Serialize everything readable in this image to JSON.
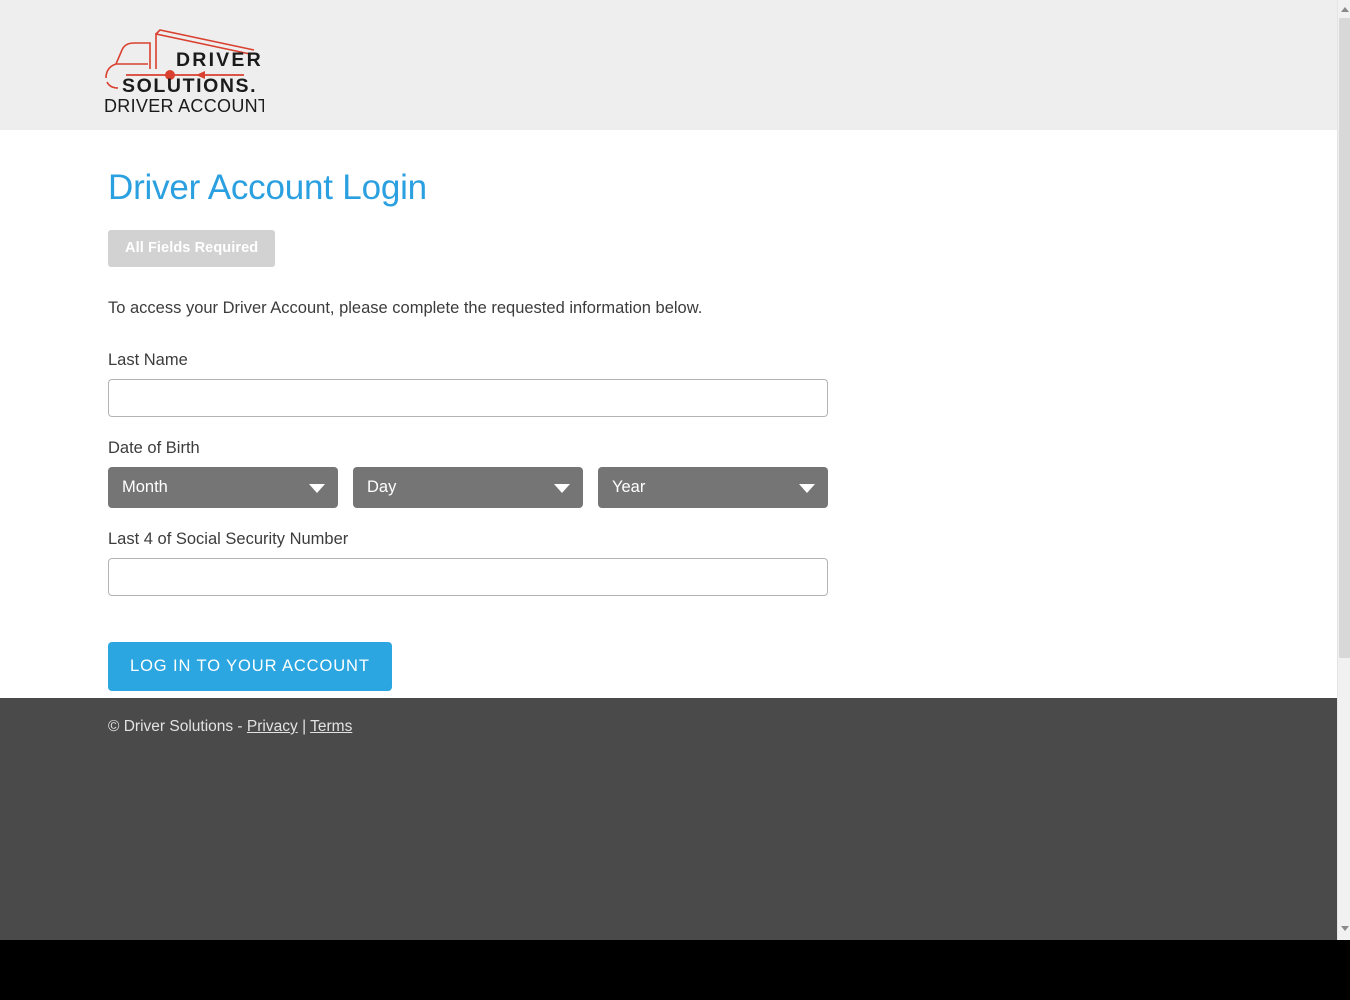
{
  "header": {
    "logo": {
      "name": "driver-solutions-logo",
      "line1": "DRIVER",
      "line2": "SOLUTIONS",
      "line3": "DRIVER ACCOUNT",
      "truck_color": "#d9402f",
      "text_color": "#1b1b1b"
    }
  },
  "main": {
    "title": "Driver Account Login",
    "badge": "All Fields Required",
    "intro": "To access your Driver Account, please complete the requested information below.",
    "fields": {
      "last_name": {
        "label": "Last Name",
        "value": "",
        "placeholder": ""
      },
      "date_of_birth": {
        "label": "Date of Birth",
        "selects": [
          {
            "name": "month",
            "selected": "Month"
          },
          {
            "name": "day",
            "selected": "Day"
          },
          {
            "name": "year",
            "selected": "Year"
          }
        ]
      },
      "ssn_last4": {
        "label": "Last 4 of Social Security Number",
        "value": "",
        "placeholder": ""
      }
    },
    "submit_label": "LOG IN TO YOUR ACCOUNT"
  },
  "footer": {
    "copyright": "© Driver Solutions -",
    "privacy_link": "Privacy",
    "separator": "|",
    "terms_link": "Terms"
  },
  "colors": {
    "accent_blue": "#2ba6e0",
    "title_blue": "#2ba0e0",
    "badge_grey": "#d2d2d2",
    "select_grey": "#757575",
    "footer_grey": "#4a4a4a",
    "header_grey": "#efeeee"
  }
}
